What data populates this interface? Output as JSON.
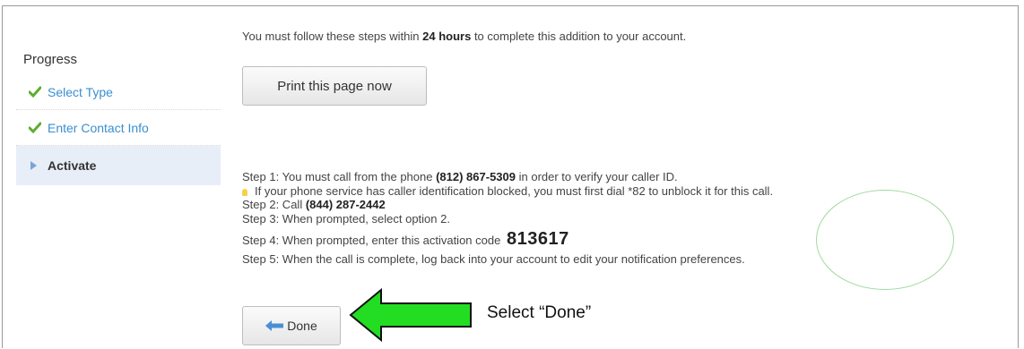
{
  "sidebar": {
    "title": "Progress",
    "items": [
      {
        "label": "Select Type",
        "state": "done"
      },
      {
        "label": "Enter Contact Info",
        "state": "done"
      },
      {
        "label": "Activate",
        "state": "active"
      }
    ]
  },
  "intro": {
    "prefix": "You must follow these steps within ",
    "bold": "24 hours",
    "suffix": " to complete this addition to your account."
  },
  "print_button": {
    "label": "Print this page now"
  },
  "steps": {
    "step1_prefix": "Step 1: You must call from the phone ",
    "step1_phone": "(812) 867-5309",
    "step1_suffix": " in order to verify your caller ID.",
    "tip": "If your phone service has caller identification blocked, you must first dial *82 to unblock it for this call.",
    "step2_prefix": "Step 2: Call ",
    "step2_phone": "(844) 287-2442",
    "step3": "Step 3: When prompted, select option 2.",
    "step4_prefix": "Step 4: When prompted, enter this activation code",
    "activation_code": "813617",
    "step5": "Step 5: When the call is complete, log back into your account to edit your notification preferences."
  },
  "done_button": {
    "label": "Done"
  },
  "annotation": {
    "text": "Select “Done”"
  },
  "colors": {
    "link": "#3a8fd0",
    "check": "#5cae2e",
    "active_bg": "#e7eef8",
    "annotation_arrow": "#22dd22",
    "annotation_circle": "#9fd99f"
  },
  "icons": [
    "check-icon",
    "triangle-right-icon",
    "lightbulb-icon",
    "arrow-left-icon"
  ]
}
